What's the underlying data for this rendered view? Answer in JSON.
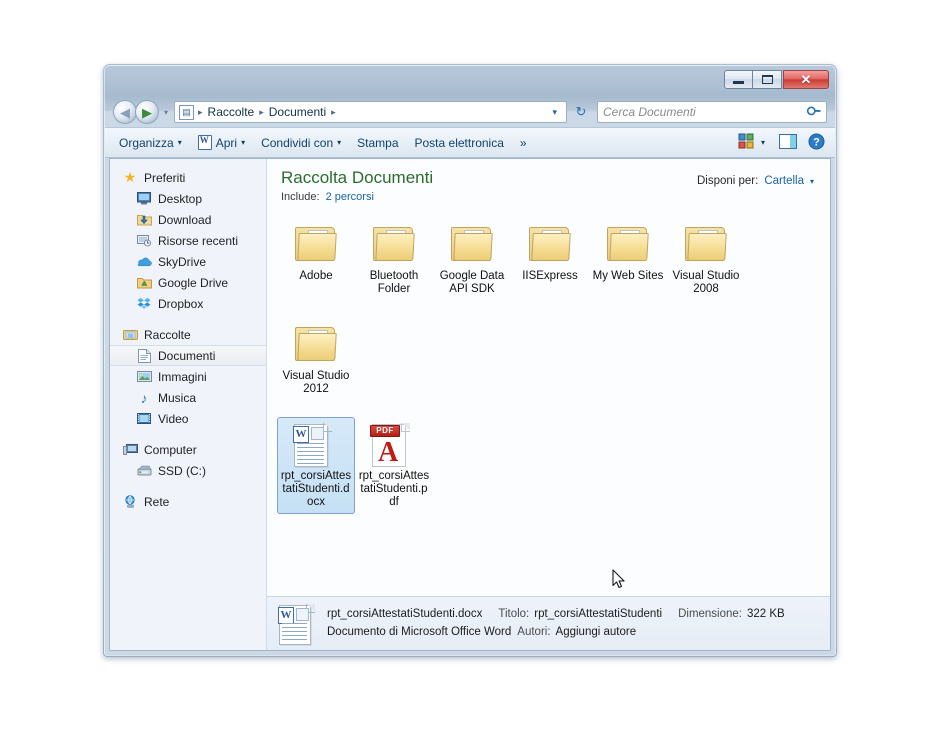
{
  "window": {
    "controls": {
      "minimize": "minimize",
      "maximize": "maximize",
      "close": "✕"
    }
  },
  "address_bar": {
    "back_label": "◀",
    "forward_label": "▶",
    "history_caret": "▾",
    "path_icon": "library-icon",
    "crumbs": [
      "Raccolte",
      "Documenti"
    ],
    "separator": "▸",
    "dropdown_caret": "▾",
    "refresh_label": "↻",
    "search_placeholder": "Cerca Documenti",
    "search_value": "",
    "search_icon": "🔍"
  },
  "toolbar": {
    "organize": "Organizza",
    "open": "Apri",
    "share_with": "Condividi con",
    "print": "Stampa",
    "email": "Posta elettronica",
    "overflow": "»",
    "caret": "▾",
    "views_icon": "view-tiles-icon",
    "views_caret": "▾",
    "preview_icon": "preview-pane-icon",
    "help_icon": "?"
  },
  "sidebar": {
    "groups": [
      {
        "name": "preferiti",
        "header": {
          "label": "Preferiti",
          "icon": "star-icon",
          "glyph": "★",
          "color": "#f0b429"
        },
        "items": [
          {
            "label": "Desktop",
            "icon": "desktop-icon",
            "glyph": "🖥",
            "color": "#4a7fb5"
          },
          {
            "label": "Download",
            "icon": "download-folder-icon",
            "glyph": "⬇",
            "color": "#2d7bc4"
          },
          {
            "label": "Risorse recenti",
            "icon": "recent-places-icon",
            "glyph": "🗔",
            "color": "#6b7f93"
          },
          {
            "label": "SkyDrive",
            "icon": "skydrive-cloud-icon",
            "glyph": "☁",
            "color": "#2e7cc4"
          },
          {
            "label": "Google Drive",
            "icon": "google-drive-icon",
            "glyph": "▲",
            "color": "#3c9a3c"
          },
          {
            "label": "Dropbox",
            "icon": "dropbox-icon",
            "glyph": "❖",
            "color": "#3fa2e8"
          }
        ]
      },
      {
        "name": "raccolte",
        "header": {
          "label": "Raccolte",
          "icon": "libraries-icon",
          "glyph": "▤",
          "color": "#5b9bd5"
        },
        "items": [
          {
            "label": "Documenti",
            "icon": "documents-library-icon",
            "glyph": "▤",
            "color": "#7aa7d0",
            "selected": true
          },
          {
            "label": "Immagini",
            "icon": "pictures-library-icon",
            "glyph": "▦",
            "color": "#5d9e5d"
          },
          {
            "label": "Musica",
            "icon": "music-library-icon",
            "glyph": "♪",
            "color": "#2f7fc1"
          },
          {
            "label": "Video",
            "icon": "video-library-icon",
            "glyph": "▣",
            "color": "#3b6fa8"
          }
        ]
      },
      {
        "name": "computer",
        "header": {
          "label": "Computer",
          "icon": "computer-icon",
          "glyph": "🖳",
          "color": "#5a7fa8"
        },
        "items": [
          {
            "label": "SSD (C:)",
            "icon": "hard-disk-icon",
            "glyph": "▬",
            "color": "#7a8b9c"
          }
        ]
      },
      {
        "name": "rete",
        "header": {
          "label": "Rete",
          "icon": "network-icon",
          "glyph": "🌐",
          "color": "#2f7fc1"
        },
        "items": []
      }
    ]
  },
  "content": {
    "title": "Raccolta Documenti",
    "include_label": "Include:",
    "include_value": "2 percorsi",
    "arrange_label": "Disponi per:",
    "arrange_value": "Cartella",
    "arrange_caret": "▾",
    "items": [
      {
        "name": "Adobe",
        "type": "folder"
      },
      {
        "name": "Bluetooth Folder",
        "type": "folder"
      },
      {
        "name": "Google Data API SDK",
        "type": "folder"
      },
      {
        "name": "IISExpress",
        "type": "folder"
      },
      {
        "name": "My Web Sites",
        "type": "folder"
      },
      {
        "name": "Visual Studio 2008",
        "type": "folder"
      },
      {
        "name": "Visual Studio 2012",
        "type": "folder"
      },
      {
        "name": "rpt_corsiAttestatiStudenti.docx",
        "type": "docx",
        "selected": true
      },
      {
        "name": "rpt_corsiAttestatiStudenti.pdf",
        "type": "pdf",
        "badge": "PDF"
      }
    ]
  },
  "details": {
    "file_name": "rpt_corsiAttestatiStudenti.docx",
    "file_type": "Documento di Microsoft Office Word",
    "title_key": "Titolo:",
    "title_value": "rpt_corsiAttestatiStudenti",
    "authors_key": "Autori:",
    "authors_value": "Aggiungi autore",
    "size_key": "Dimensione:",
    "size_value": "322 KB"
  },
  "colors": {
    "title_green": "#2c6b2c",
    "link_blue": "#1a62a8",
    "selection_blue": "#c5e0f5",
    "frame_blue": "#9fb4ca"
  }
}
